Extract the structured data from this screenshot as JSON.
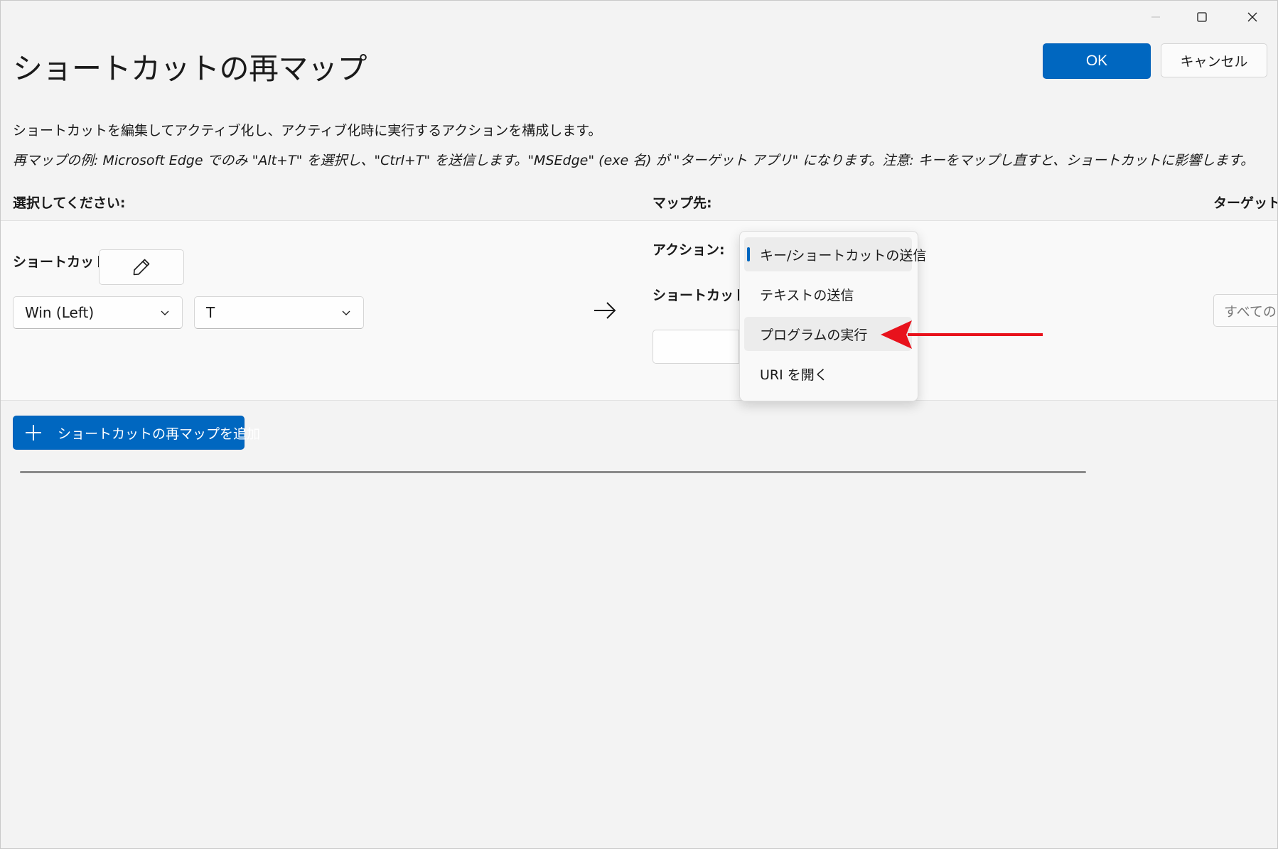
{
  "window": {
    "title": "ショートカットの再マップ",
    "ok_label": "OK",
    "cancel_label": "キャンセル"
  },
  "description": "ショートカットを編集してアクティブ化し、アクティブ化時に実行するアクションを構成します。",
  "example": "再マップの例: Microsoft Edge でのみ \"Alt+T\" を選択し、\"Ctrl+T\" を送信します。\"MSEdge\" (exe 名) が \"ターゲット アプリ\" になります。注意: キーをマップし直すと、ショートカットに影響します。",
  "columns": {
    "select": "選択してください:",
    "map_to": "マップ先:",
    "target_app": "ターゲット アプリ:"
  },
  "row": {
    "shortcut_label": "ショートカット:",
    "key1": "Win (Left)",
    "key2": "T",
    "action_label": "アクション:",
    "map_shortcut_label": "ショートカット:",
    "target_placeholder": "すべてのアプリ"
  },
  "action_dropdown": {
    "items": [
      {
        "label": "キー/ショートカットの送信",
        "selected": true
      },
      {
        "label": "テキストの送信",
        "selected": false
      },
      {
        "label": "プログラムの実行",
        "selected": false
      },
      {
        "label": "URI を開く",
        "selected": false
      }
    ]
  },
  "add_button_label": "ショートカットの再マップを追加",
  "icons": {
    "edit": "pencil-icon",
    "chevron": "chevron-down-icon",
    "arrow": "arrow-right-icon",
    "add": "plus-icon",
    "minimize": "minimize-icon",
    "maximize": "maximize-icon",
    "close": "close-icon",
    "annotation": "red-arrow-annotation"
  },
  "colors": {
    "accent": "#0067c0",
    "annotation": "#e8121c"
  }
}
